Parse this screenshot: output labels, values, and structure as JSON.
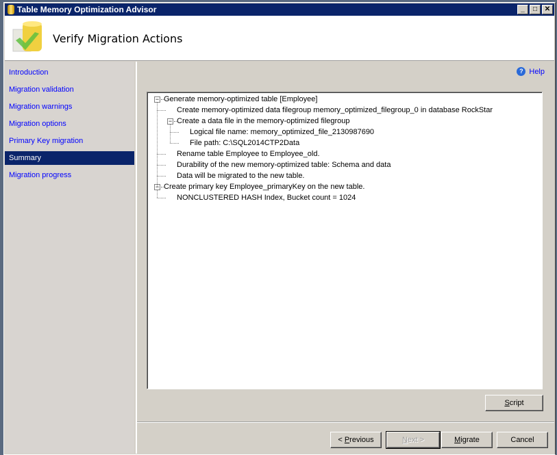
{
  "window": {
    "title": "Table Memory Optimization Advisor",
    "controls": [
      "_",
      "□",
      "✕"
    ]
  },
  "header": {
    "title": "Verify Migration Actions",
    "icon": "database-migrate-icon"
  },
  "sidebar": {
    "items": [
      {
        "label": "Introduction"
      },
      {
        "label": "Migration validation"
      },
      {
        "label": "Migration warnings"
      },
      {
        "label": "Migration options"
      },
      {
        "label": "Primary Key migration"
      },
      {
        "label": "Summary",
        "selected": true
      },
      {
        "label": "Migration progress"
      }
    ]
  },
  "help": {
    "label": "Help"
  },
  "tree": [
    {
      "level": 0,
      "text": "Generate memory-optimized table [Employee]"
    },
    {
      "level": 1,
      "text": "Create memory-optimized data filegroup memory_optimized_filegroup_0 in database RockStar"
    },
    {
      "level": 1,
      "text": "Create a data file in the memory-optimized filegroup"
    },
    {
      "level": 2,
      "text": "Logical file name: memory_optimized_file_2130987690"
    },
    {
      "level": 2,
      "text": "File path: C:\\SQL2014CTP2Data"
    },
    {
      "level": 1,
      "text": "Rename table Employee to Employee_old."
    },
    {
      "level": 1,
      "text": "Durability of the new memory-optimized table: Schema and data"
    },
    {
      "level": 1,
      "text": "Data will be migrated to the new table."
    },
    {
      "level": 0,
      "text": "Create primary key Employee_primaryKey on the new table."
    },
    {
      "level": 1,
      "text": "NONCLUSTERED HASH Index, Bucket count = 1024"
    }
  ],
  "buttons": {
    "script_key": "S",
    "script_rest": "cript",
    "prev_pre": "< ",
    "prev_key": "P",
    "prev_rest": "revious",
    "next_key": "N",
    "next_rest": "ext >",
    "migrate_key": "M",
    "migrate_rest": "igrate",
    "cancel": "Cancel"
  }
}
